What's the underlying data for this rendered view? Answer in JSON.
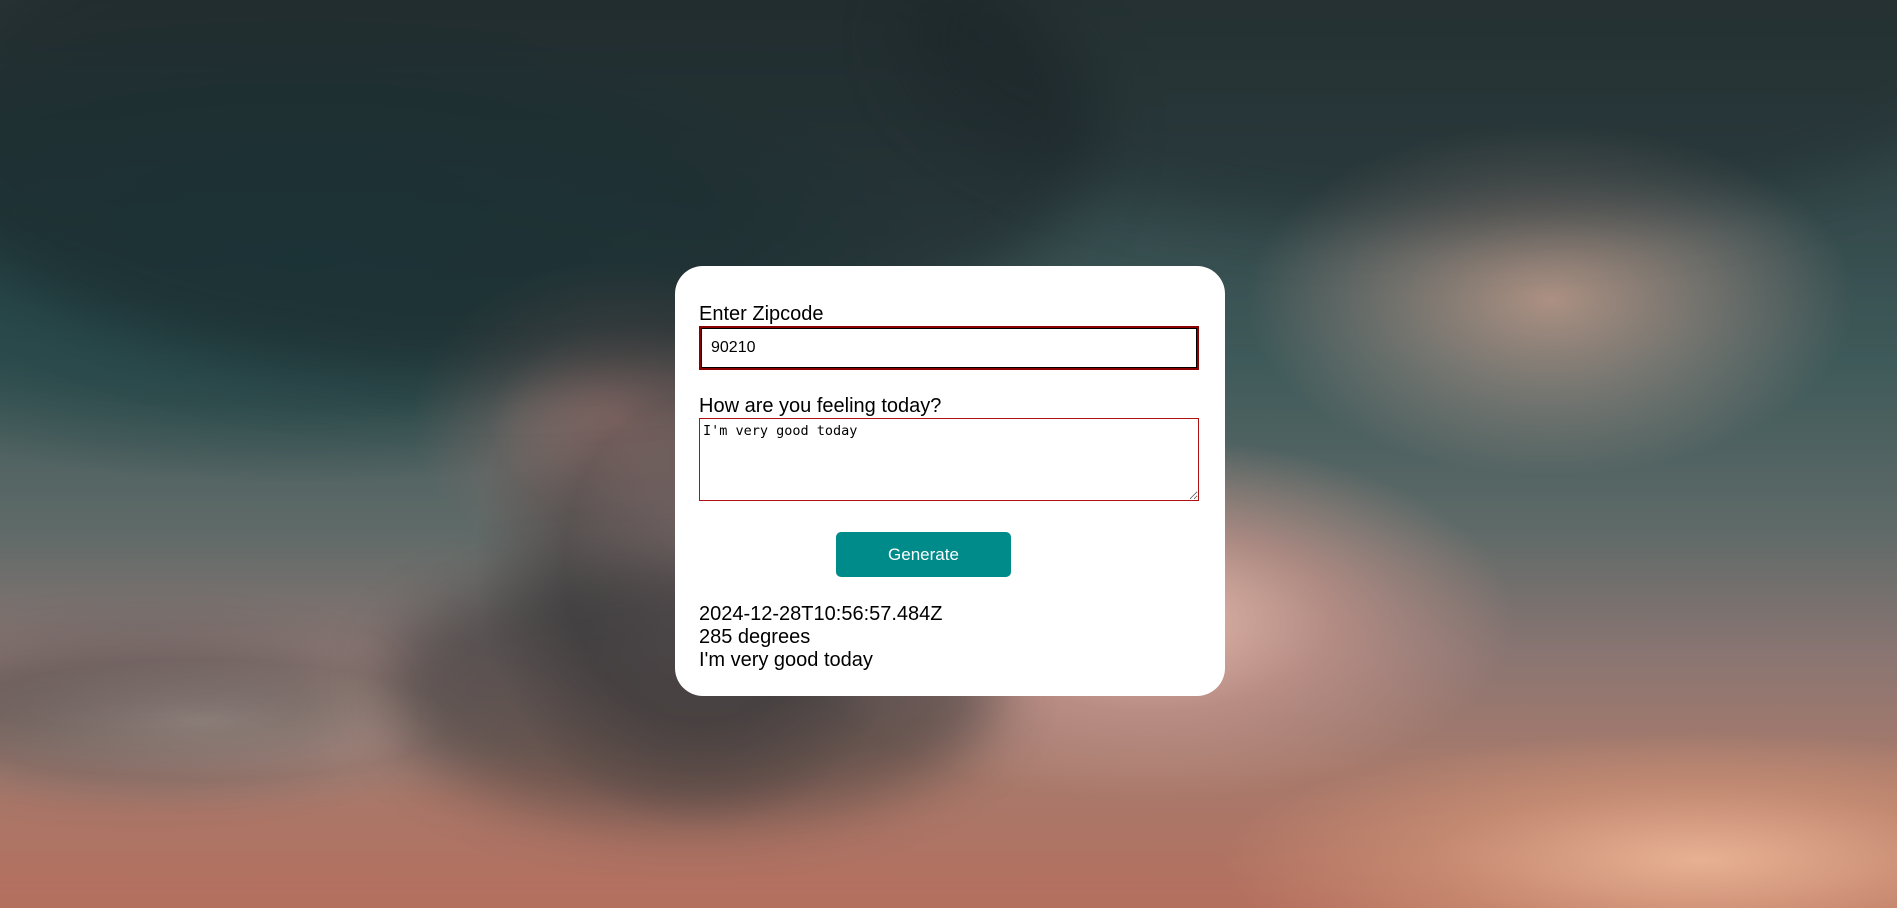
{
  "form": {
    "zip_label": "Enter Zipcode",
    "zip_value": "90210",
    "feeling_label": "How are you feeling today?",
    "feeling_value": "I'm very good today",
    "generate_label": "Generate"
  },
  "results": {
    "date": "2024-12-28T10:56:57.484Z",
    "temperature": "285 degrees",
    "feeling": "I'm very good today"
  },
  "colors": {
    "button": "#008b8b",
    "input_border": "#8b0000",
    "card": "#ffffff"
  }
}
